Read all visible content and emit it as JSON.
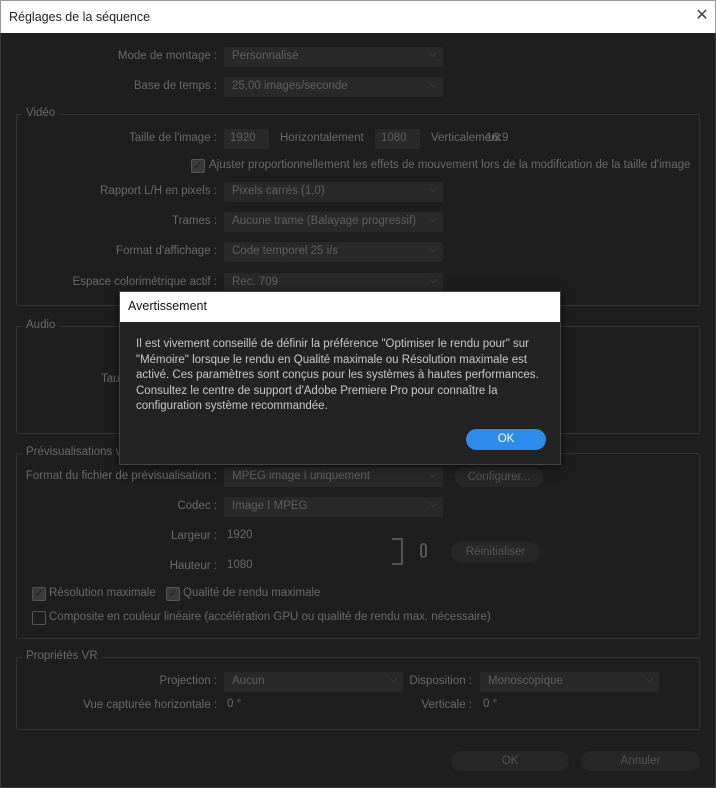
{
  "window": {
    "title": "Réglages de la séquence",
    "close": "✕"
  },
  "general": {
    "mode_label": "Mode de montage :",
    "mode_value": "Personnalisé",
    "timebase_label": "Base de temps :",
    "timebase_value": "25,00  images/seconde"
  },
  "video": {
    "legend": "Vidéo",
    "frame_label": "Taille de l'image :",
    "width": "1920",
    "horizontal": "Horizontalement",
    "height": "1080",
    "vertical": "Verticalement",
    "aspect": "16:9",
    "scale_checkbox": "Ajuster proportionnellement les effets de mouvement lors de la modification de la taille d'image",
    "scale_checked": true,
    "par_label": "Rapport L/H en pixels :",
    "par_value": "Pixels carrés (1,0)",
    "fields_label": "Trames :",
    "fields_value": "Aucune trame (Balayage progressif)",
    "display_label": "Format d'affichage :",
    "display_value": "Code temporel 25 i/s",
    "color_label": "Espace colorimétrique actif :",
    "color_value": "Rec. 709"
  },
  "audio": {
    "legend": "Audio",
    "rate_label_partial": "Tau"
  },
  "preview": {
    "legend": "Prévisualisations vidéo",
    "format_label": "Format du fichier de prévisualisation :",
    "format_value": "MPEG image I uniquement",
    "configure": "Configurer...",
    "codec_label": "Codec :",
    "codec_value": "Image I MPEG",
    "width_label": "Largeur :",
    "width": "1920",
    "height_label": "Hauteur :",
    "height": "1080",
    "reset": "Réinitialiser",
    "max_res": "Résolution maximale",
    "max_res_checked": true,
    "max_quality": "Qualité de rendu maximale",
    "max_quality_checked": true,
    "linear": "Composite en couleur linéaire (accélération GPU ou qualité de rendu max. nécessaire)",
    "linear_checked": false
  },
  "vr": {
    "legend": "Propriétés VR",
    "projection_label": "Projection :",
    "projection_value": "Aucun",
    "layout_label": "Disposition :",
    "layout_value": "Monoscopique",
    "hfov_label": "Vue capturée horizontale :",
    "hfov": "0 °",
    "vfov_label": "Verticale :",
    "vfov": "0 °"
  },
  "footer": {
    "ok": "OK",
    "cancel": "Annuler"
  },
  "alert": {
    "title": "Avertissement",
    "message": "Il est vivement conseillé de définir la préférence \"Optimiser le rendu pour\" sur \"Mémoire\" lorsque le rendu en Qualité maximale ou Résolution maximale est activé. Ces paramètres sont conçus pour les systèmes à hautes performances. Consultez le centre de support d'Adobe Premiere Pro pour connaître la configuration système recommandée.",
    "ok": "OK",
    "ok_color": "#2d8ceb"
  }
}
